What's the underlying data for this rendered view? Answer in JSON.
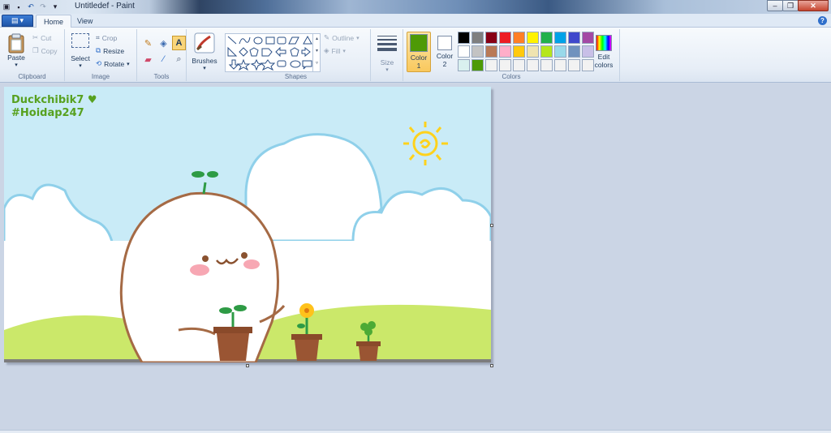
{
  "window": {
    "title": "Untitledef - Paint"
  },
  "tabs": [
    {
      "label": "Home"
    },
    {
      "label": "View"
    }
  ],
  "clipboard": {
    "paste": "Paste",
    "cut": "Cut",
    "copy": "Copy",
    "group": "Clipboard"
  },
  "image": {
    "select": "Select",
    "crop": "Crop",
    "resize": "Resize",
    "rotate": "Rotate",
    "group": "Image"
  },
  "tools": {
    "group": "Tools"
  },
  "brushes": {
    "label": "Brushes"
  },
  "shapes": {
    "outline": "Outline",
    "fill": "Fill",
    "group": "Shapes"
  },
  "size": {
    "label": "Size"
  },
  "colors": {
    "color1_label": "Color",
    "color1_num": "1",
    "color2_label": "Color",
    "color2_num": "2",
    "edit_label": "Edit",
    "edit_label2": "colors",
    "group": "Colors",
    "color1_value": "#4e9a06",
    "color2_value": "#ffffff",
    "palette": [
      "#000000",
      "#7f7f7f",
      "#880015",
      "#ed1c24",
      "#ff7f27",
      "#fff200",
      "#22b14c",
      "#00a2e8",
      "#3f48cc",
      "#a349a4",
      "#ffffff",
      "#c3c3c3",
      "#b97a57",
      "#ffaec9",
      "#ffc90e",
      "#efe4b0",
      "#b5e61d",
      "#99d9ea",
      "#7092be",
      "#c8bfe7",
      "#d9f0ef",
      "#4e9a06",
      "#f2f2f2",
      "#f2f2f2",
      "#f2f2f2",
      "#f2f2f2",
      "#f2f2f2",
      "#f2f2f2",
      "#f2f2f2",
      "#f2f2f2"
    ]
  },
  "canvas": {
    "watermark1": "Duckchibik7",
    "watermark2": "#Hoidap247"
  }
}
